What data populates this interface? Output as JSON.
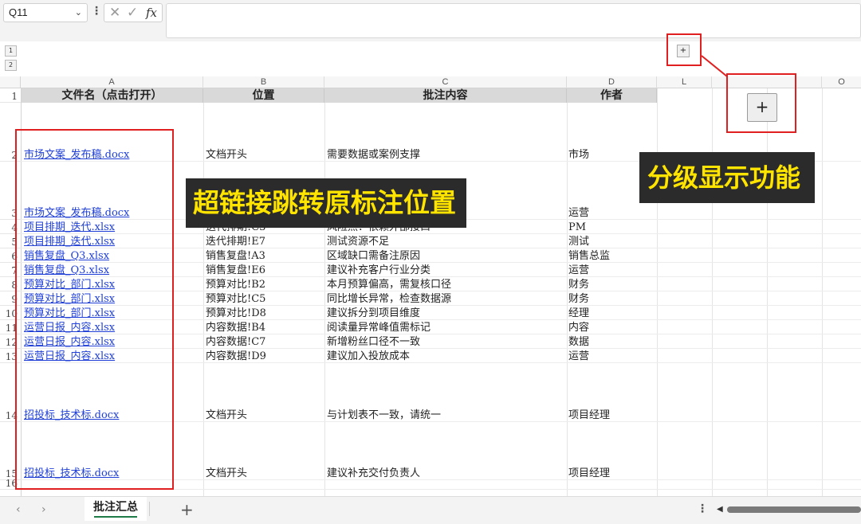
{
  "formula_bar": {
    "name_box": "Q11",
    "cancel_icon": "✕",
    "confirm_icon": "✓",
    "fx_label": "fx",
    "formula": ""
  },
  "outline": {
    "levels": [
      "1",
      "2"
    ],
    "expand_label": "+"
  },
  "columns": [
    "A",
    "B",
    "C",
    "D",
    "L",
    "",
    "O"
  ],
  "header_row": {
    "row_num": "1",
    "cells": [
      "文件名（点击打开）",
      "位置",
      "批注内容",
      "作者"
    ]
  },
  "rows": [
    {
      "num": "2",
      "file": "市场文案_发布稿.docx",
      "loc": "文档开头",
      "note": "需要数据或案例支撑",
      "author": "市场"
    },
    {
      "num": "3",
      "file": "市场文案_发布稿.docx",
      "loc": "",
      "note": "",
      "author": "运营"
    },
    {
      "num": "4",
      "file": "项目排期_迭代.xlsx",
      "loc": "迭代排期!C3",
      "note": "风险点：依赖外部接口",
      "author": "PM"
    },
    {
      "num": "5",
      "file": "项目排期_迭代.xlsx",
      "loc": "迭代排期!E7",
      "note": "测试资源不足",
      "author": "测试"
    },
    {
      "num": "6",
      "file": "销售复盘_Q3.xlsx",
      "loc": "销售复盘!A3",
      "note": "区域缺口需备注原因",
      "author": "销售总监"
    },
    {
      "num": "7",
      "file": "销售复盘_Q3.xlsx",
      "loc": "销售复盘!E6",
      "note": "建议补充客户行业分类",
      "author": "运营"
    },
    {
      "num": "8",
      "file": "预算对比_部门.xlsx",
      "loc": "预算对比!B2",
      "note": "本月预算偏高，需复核口径",
      "author": "财务"
    },
    {
      "num": "9",
      "file": "预算对比_部门.xlsx",
      "loc": "预算对比!C5",
      "note": "同比增长异常，检查数据源",
      "author": "财务"
    },
    {
      "num": "10",
      "file": "预算对比_部门.xlsx",
      "loc": "预算对比!D8",
      "note": "建议拆分到项目维度",
      "author": "经理"
    },
    {
      "num": "11",
      "file": "运营日报_内容.xlsx",
      "loc": "内容数据!B4",
      "note": "阅读量异常峰值需标记",
      "author": "内容"
    },
    {
      "num": "12",
      "file": "运营日报_内容.xlsx",
      "loc": "内容数据!C7",
      "note": "新增粉丝口径不一致",
      "author": "数据"
    },
    {
      "num": "13",
      "file": "运营日报_内容.xlsx",
      "loc": "内容数据!D9",
      "note": "建议加入投放成本",
      "author": "运营"
    },
    {
      "num": "14",
      "file": "招投标_技术标.docx",
      "loc": "文档开头",
      "note": "与计划表不一致，请统一",
      "author": "项目经理"
    },
    {
      "num": "15",
      "file": "招投标_技术标.docx",
      "loc": "文档开头",
      "note": "建议补充交付负责人",
      "author": "项目经理"
    },
    {
      "num": "16",
      "file": "",
      "loc": "",
      "note": "",
      "author": ""
    }
  ],
  "annotations": {
    "hyperlink_label": "超链接跳转原标注位置",
    "outline_label": "分级显示功能",
    "plus_label": "+"
  },
  "sheet_tabs": {
    "active": "批注汇总",
    "add_label": "+",
    "prev_label": "‹",
    "next_label": "›",
    "menu_label": "⋮"
  }
}
